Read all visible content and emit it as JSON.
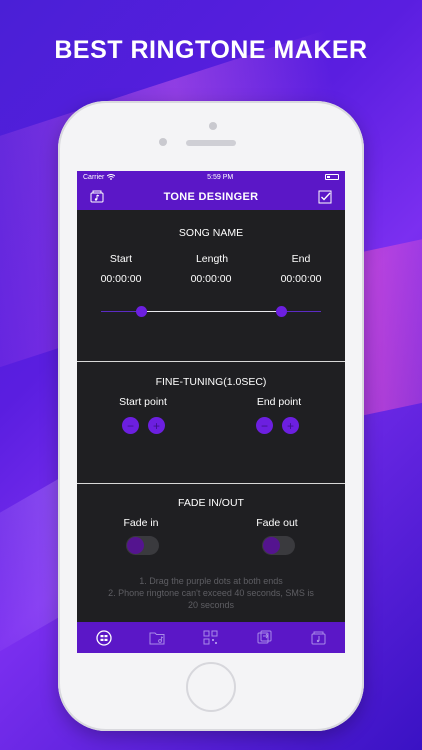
{
  "headline": "BEST RINGTONE MAKER",
  "status_bar": {
    "carrier": "Carrier",
    "time": "5:59 PM"
  },
  "nav": {
    "title": "TONE DESINGER",
    "left_icon": "music-folder-icon",
    "right_icon": "checkbox-icon"
  },
  "song": {
    "name": "SONG NAME",
    "start_label": "Start",
    "length_label": "Length",
    "end_label": "End",
    "start_value": "00:00:00",
    "length_value": "00:00:00",
    "end_value": "00:00:00"
  },
  "fine_tuning": {
    "title": "FINE-TUNING(1.0SEC)",
    "start_label": "Start point",
    "end_label": "End point",
    "minus": "−",
    "plus": "+"
  },
  "fade": {
    "title": "FADE IN/OUT",
    "in_label": "Fade in",
    "out_label": "Fade out"
  },
  "notes": {
    "line1": "1. Drag the purple dots at both ends",
    "line2": "2. Phone ringtone can't exceed 40 seconds, SMS is",
    "line3": "20 seconds"
  },
  "tabs": [
    "designer-icon",
    "folder-music-icon",
    "qr-grid-icon",
    "convert-icon",
    "ringtone-icon"
  ],
  "colors": {
    "accent": "#5b17c7",
    "dark": "#1f1f22",
    "dot": "#6c1fe0"
  }
}
